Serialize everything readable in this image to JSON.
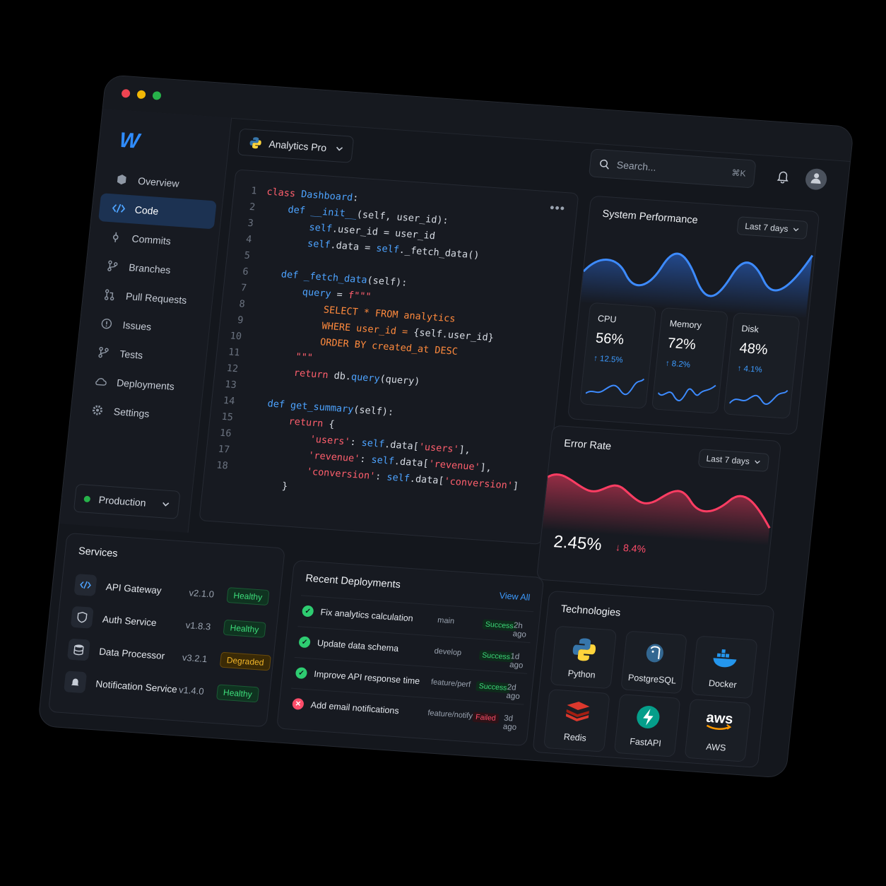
{
  "app": {
    "logo": "W"
  },
  "sidebar": {
    "items": [
      {
        "label": "Overview",
        "icon": "cube-icon"
      },
      {
        "label": "Code",
        "icon": "code-icon",
        "active": true
      },
      {
        "label": "Commits",
        "icon": "commit-icon"
      },
      {
        "label": "Branches",
        "icon": "branch-icon"
      },
      {
        "label": "Pull Requests",
        "icon": "pull-request-icon"
      },
      {
        "label": "Issues",
        "icon": "issue-icon"
      },
      {
        "label": "Tests",
        "icon": "test-icon"
      },
      {
        "label": "Deployments",
        "icon": "cloud-icon"
      },
      {
        "label": "Settings",
        "icon": "gear-icon"
      }
    ],
    "environment": "Production"
  },
  "header": {
    "project": "Analytics Pro",
    "search_placeholder": "Search...",
    "search_shortcut": "⌘K"
  },
  "editor": {
    "line_numbers": [
      "1",
      "2",
      "3",
      "4",
      "5",
      "6",
      "7",
      "8",
      "9",
      "10",
      "11",
      "12",
      "13",
      "14",
      "15",
      "16",
      "17",
      "18"
    ]
  },
  "performance": {
    "title": "System Performance",
    "range": "Last 7 days",
    "metrics": [
      {
        "label": "CPU",
        "value": "56%",
        "change": "↑ 12.5%"
      },
      {
        "label": "Memory",
        "value": "72%",
        "change": "↑ 8.2%"
      },
      {
        "label": "Disk",
        "value": "48%",
        "change": "↑ 4.1%"
      }
    ]
  },
  "error_rate": {
    "title": "Error Rate",
    "range": "Last 7 days",
    "value": "2.45%",
    "change": "↓ 8.4%"
  },
  "services": {
    "title": "Services",
    "items": [
      {
        "name": "API Gateway",
        "version": "v2.1.0",
        "status": "Healthy"
      },
      {
        "name": "Auth Service",
        "version": "v1.8.3",
        "status": "Healthy"
      },
      {
        "name": "Data Processor",
        "version": "v3.2.1",
        "status": "Degraded"
      },
      {
        "name": "Notification Service",
        "version": "v1.4.0",
        "status": "Healthy"
      }
    ]
  },
  "deployments": {
    "title": "Recent Deployments",
    "view_all": "View All",
    "items": [
      {
        "title": "Fix analytics calculation",
        "branch": "main",
        "status": "Success",
        "time": "2h ago"
      },
      {
        "title": "Update data schema",
        "branch": "develop",
        "status": "Success",
        "time": "1d ago"
      },
      {
        "title": "Improve API response time",
        "branch": "feature/perf",
        "status": "Success",
        "time": "2d ago"
      },
      {
        "title": "Add email notifications",
        "branch": "feature/notify",
        "status": "Failed",
        "time": "3d ago"
      }
    ]
  },
  "technologies": {
    "title": "Technologies",
    "items": [
      "Python",
      "PostgreSQL",
      "Docker",
      "Redis",
      "FastAPI",
      "AWS"
    ]
  },
  "colors": {
    "accent": "#2f8cff",
    "healthy": "#3ddc7a",
    "degraded": "#f0b429",
    "error": "#ff4d6a"
  }
}
